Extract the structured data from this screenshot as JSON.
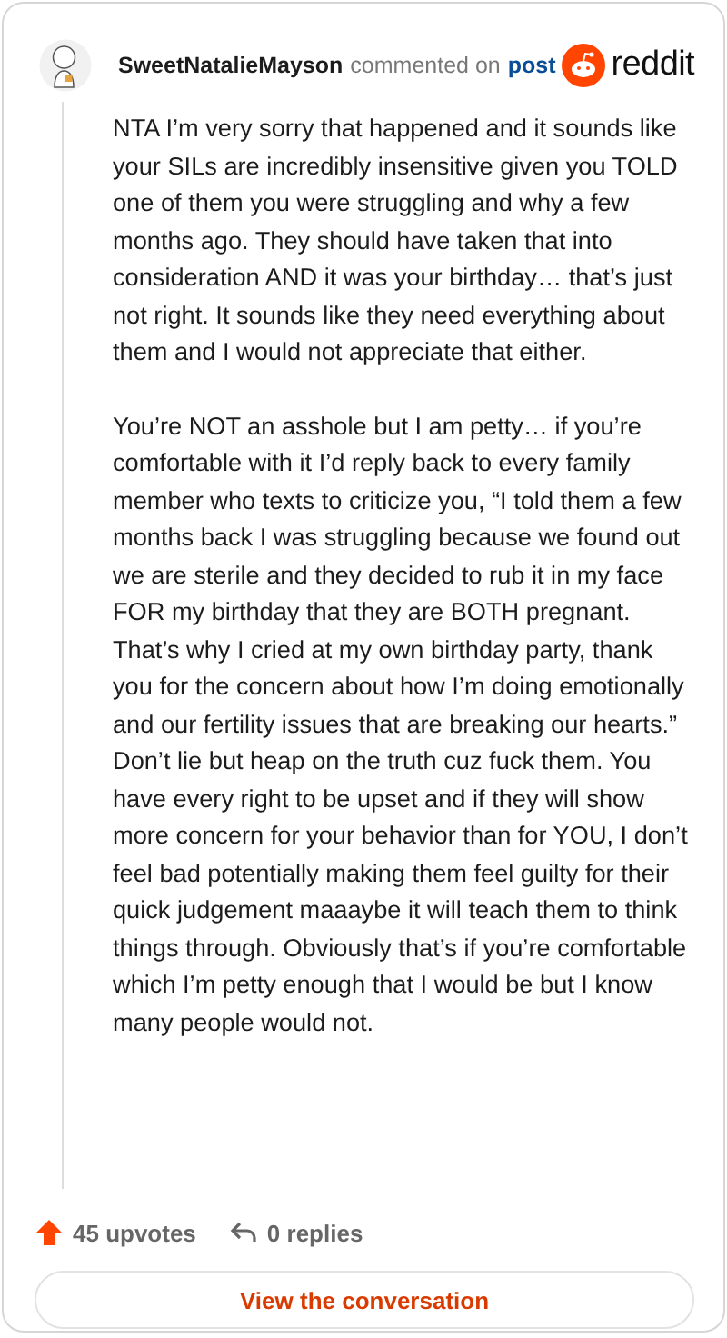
{
  "comment": {
    "author": "SweetNatalieMayson",
    "action": "commented on",
    "link": "post",
    "brand": "reddit",
    "paragraphs": [
      "NTA I’m very sorry that happened and it sounds like your SILs are incredibly insensitive given you TOLD one of them you were struggling and why a few months ago. They should have taken that into consideration AND it was your birthday… that’s just not right. It sounds like they need everything about them and I would not appreciate that either.",
      "You’re NOT an asshole but I am petty… if you’re comfortable with it I’d reply back to every family member who texts to criticize you, “I told them a few months back I was struggling because we found out we are sterile and they decided to rub it in my face FOR my birthday that they are BOTH pregnant. That’s why I cried at my own birthday party, thank you for the concern about how I’m doing emotionally and our fertility issues that are breaking our hearts.” Don’t lie but heap on the truth cuz fuck them. You have every right to be upset and if they will show more concern for your behavior than for YOU, I don’t feel bad potentially making them feel guilty for their quick judgement maaaybe it will teach them to think things through. Obviously that’s if you’re comfortable which I’m petty enough that I would be but I know many people would not."
    ],
    "upvotes": "45 upvotes",
    "replies": "0 replies",
    "button": "View the conversation"
  }
}
